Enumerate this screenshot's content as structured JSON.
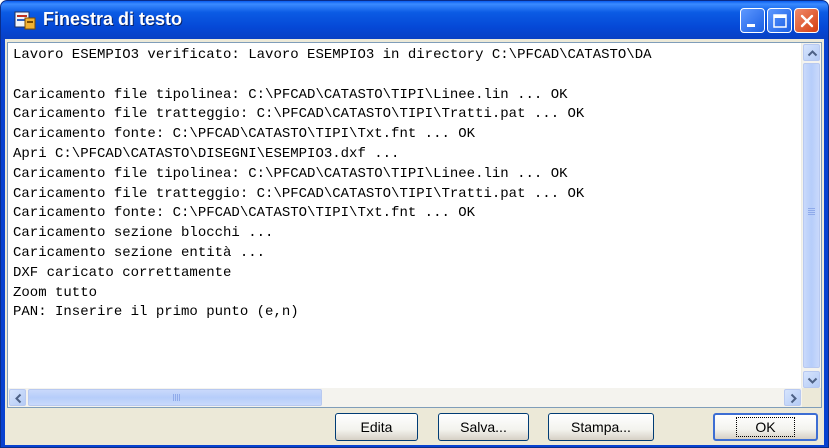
{
  "window": {
    "title": "Finestra di testo",
    "icon": "app-icon",
    "colors": {
      "titlebar": "#0548d6",
      "close": "#d43f12",
      "client": "#ece9d8",
      "textarea_border": "#7f9db9"
    }
  },
  "text_output": {
    "lines": [
      "Lavoro ESEMPIO3 verificato: Lavoro ESEMPIO3 in directory C:\\PFCAD\\CATASTO\\DA",
      "",
      "Caricamento file tipolinea: C:\\PFCAD\\CATASTO\\TIPI\\Linee.lin ... OK",
      "Caricamento file tratteggio: C:\\PFCAD\\CATASTO\\TIPI\\Tratti.pat ... OK",
      "Caricamento fonte: C:\\PFCAD\\CATASTO\\TIPI\\Txt.fnt ... OK",
      "Apri C:\\PFCAD\\CATASTO\\DISEGNI\\ESEMPIO3.dxf ...",
      "Caricamento file tipolinea: C:\\PFCAD\\CATASTO\\TIPI\\Linee.lin ... OK",
      "Caricamento file tratteggio: C:\\PFCAD\\CATASTO\\TIPI\\Tratti.pat ... OK",
      "Caricamento fonte: C:\\PFCAD\\CATASTO\\TIPI\\Txt.fnt ... OK",
      "Caricamento sezione blocchi ...",
      "Caricamento sezione entità ...",
      "DXF caricato correttamente",
      "Zoom tutto",
      "PAN: Inserire il primo punto (e,n)"
    ]
  },
  "buttons": {
    "edita": "Edita",
    "salva": "Salva...",
    "stampa": "Stampa...",
    "ok": "OK"
  }
}
